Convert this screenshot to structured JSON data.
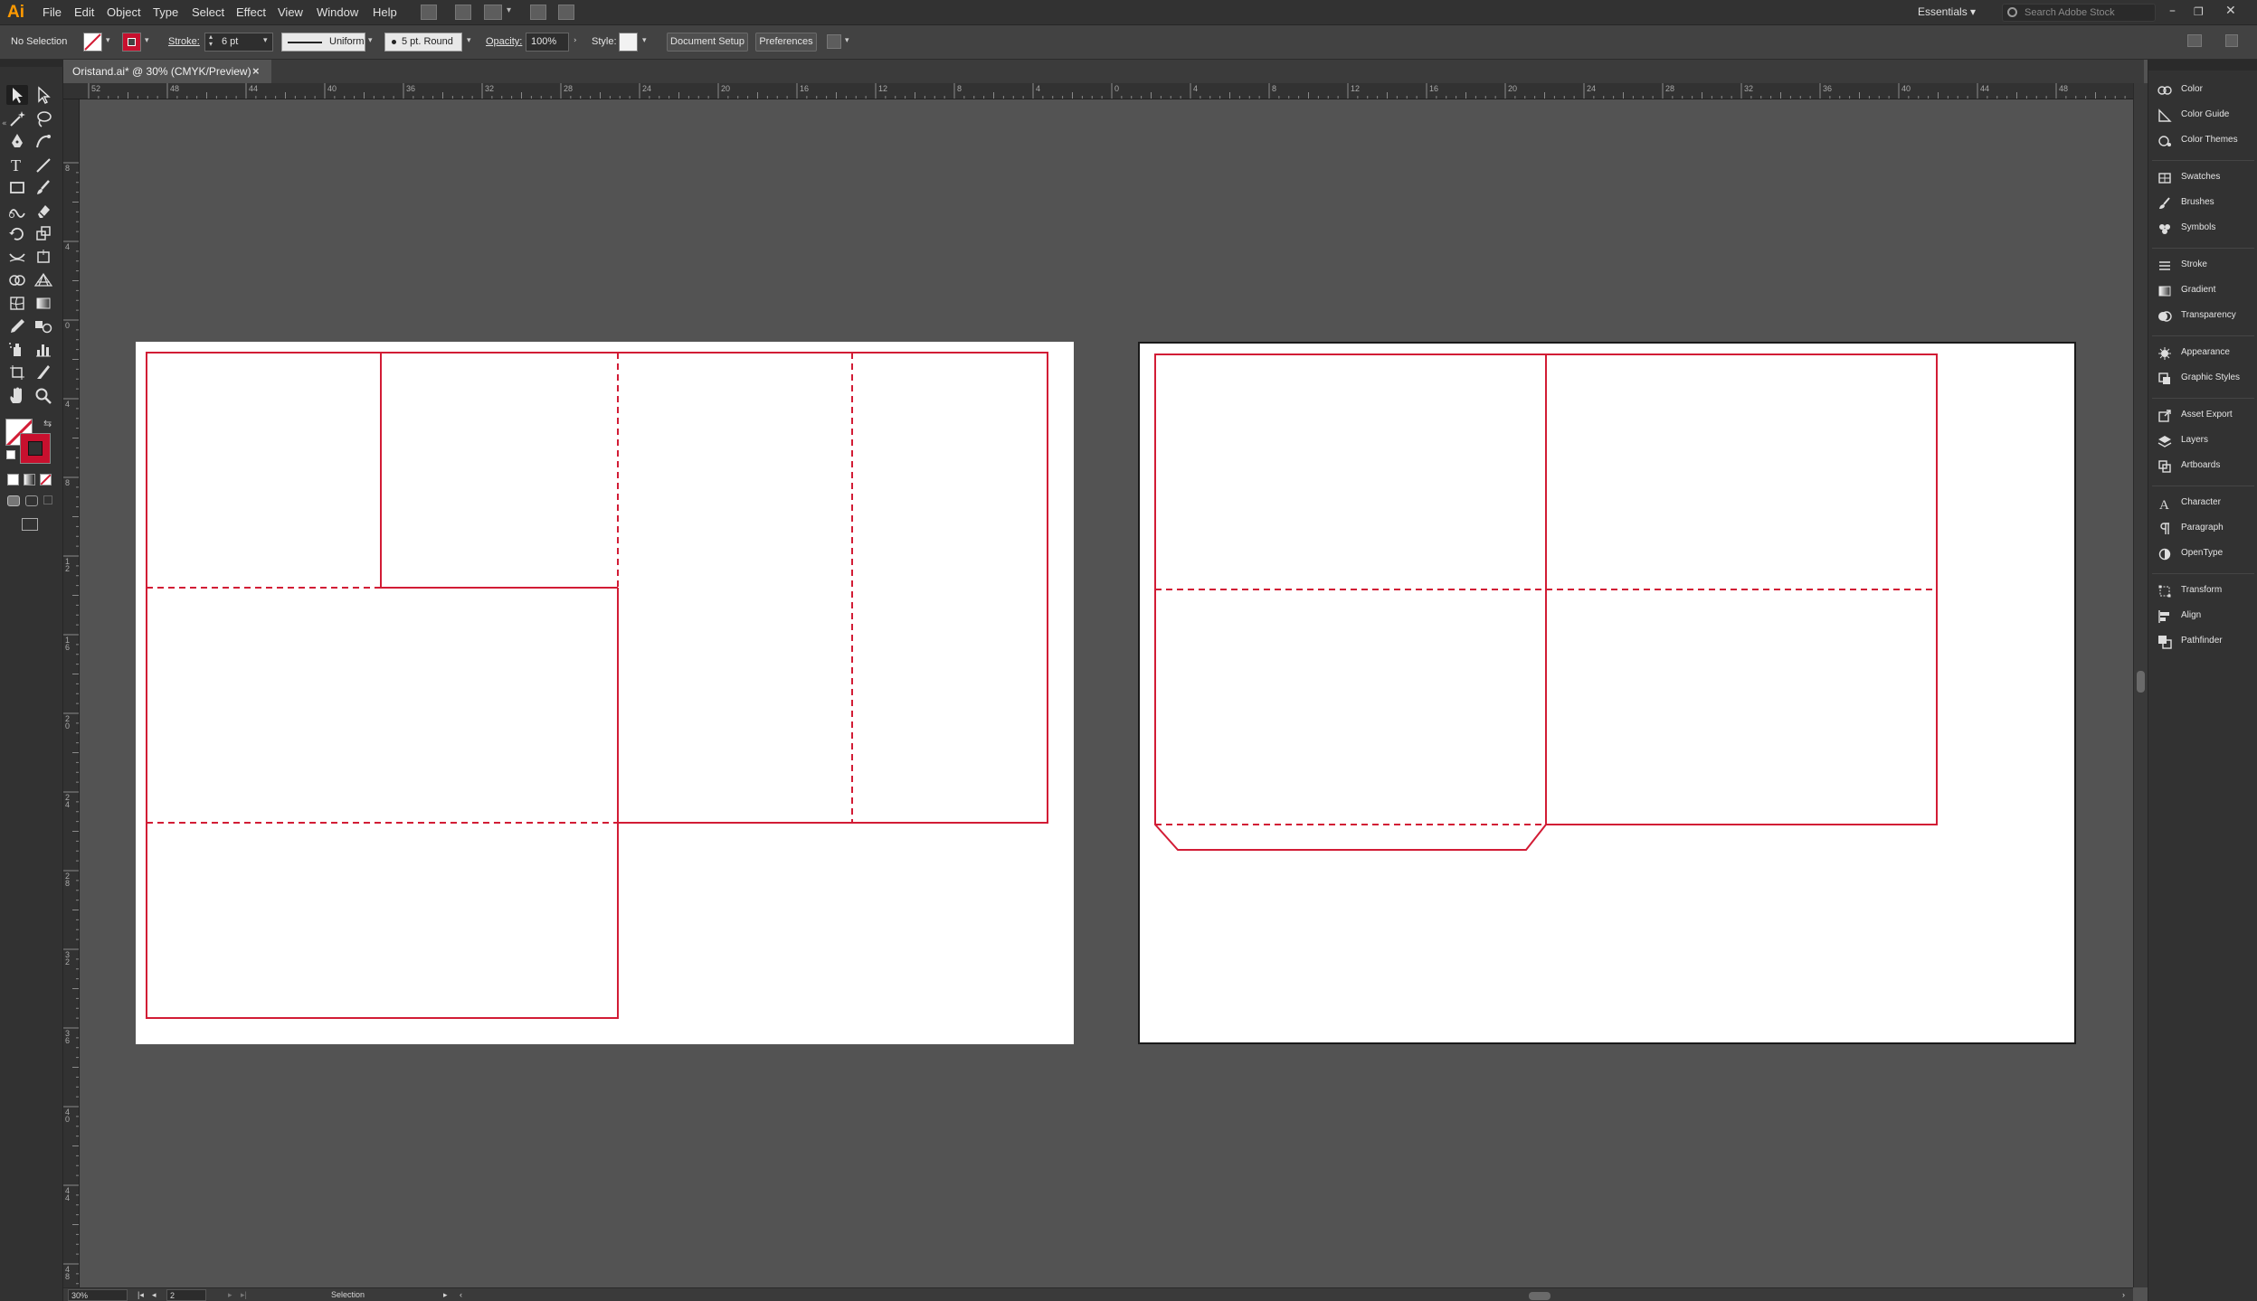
{
  "app": {
    "logo": "Ai",
    "accent": "#ff9a00"
  },
  "menubar": {
    "items": [
      "File",
      "Edit",
      "Object",
      "Type",
      "Select",
      "Effect",
      "View",
      "Window",
      "Help"
    ],
    "workspace": "Essentials",
    "search_placeholder": "Search Adobe Stock",
    "window_controls": [
      "minimize-icon",
      "restore-icon",
      "close-icon"
    ]
  },
  "controlbar": {
    "selection_state": "No Selection",
    "stroke_label": "Stroke:",
    "stroke_weight": "6 pt",
    "stroke_profile": "Uniform",
    "brush": "5 pt. Round",
    "opacity_label": "Opacity:",
    "opacity_value": "100%",
    "style_label": "Style:",
    "document_setup": "Document Setup",
    "preferences": "Preferences"
  },
  "document": {
    "tab_title": "Oristand.ai* @ 30% (CMYK/Preview)",
    "close_glyph": "×"
  },
  "rulers": {
    "top_labels": [
      "52",
      "48",
      "44",
      "40",
      "36",
      "32",
      "28",
      "24",
      "20",
      "16",
      "12",
      "8",
      "4",
      "0",
      "4",
      "8",
      "12",
      "16",
      "20",
      "24",
      "28",
      "32",
      "36",
      "40",
      "44",
      "48"
    ],
    "left_labels": [
      "8",
      "4",
      "0",
      "4",
      "8",
      "1 2",
      "1 6",
      "2 0",
      "2 4",
      "2 8",
      "3 2",
      "3 6",
      "4 0",
      "4 4",
      "4 8"
    ]
  },
  "statusbar": {
    "zoom": "30%",
    "artboard_number": "2",
    "current_tool": "Selection"
  },
  "colors": {
    "cut_line": "#d21c35",
    "canvas": "#535353",
    "chrome_dark": "#323232",
    "stroke_swatch": "#c8102e"
  },
  "tools": [
    "selection-tool",
    "direct-selection-tool",
    "magic-wand-tool",
    "lasso-tool",
    "pen-tool",
    "curvature-tool",
    "type-tool",
    "line-segment-tool",
    "rectangle-tool",
    "paintbrush-tool",
    "shaper-tool",
    "eraser-tool",
    "rotate-tool",
    "scale-tool",
    "width-tool",
    "free-transform-tool",
    "shape-builder-tool",
    "perspective-grid-tool",
    "mesh-tool",
    "gradient-tool",
    "eyedropper-tool",
    "blend-tool",
    "symbol-sprayer-tool",
    "column-graph-tool",
    "artboard-tool",
    "slice-tool",
    "hand-tool",
    "zoom-tool"
  ],
  "panels": [
    {
      "label": "Color",
      "icon": "color-icon"
    },
    {
      "label": "Color Guide",
      "icon": "color-guide-icon"
    },
    {
      "label": "Color Themes",
      "icon": "color-themes-icon"
    },
    {
      "label": "Swatches",
      "icon": "swatches-icon"
    },
    {
      "label": "Brushes",
      "icon": "brushes-icon"
    },
    {
      "label": "Symbols",
      "icon": "symbols-icon"
    },
    {
      "label": "Stroke",
      "icon": "stroke-icon"
    },
    {
      "label": "Gradient",
      "icon": "gradient-icon"
    },
    {
      "label": "Transparency",
      "icon": "transparency-icon"
    },
    {
      "label": "Appearance",
      "icon": "appearance-icon"
    },
    {
      "label": "Graphic Styles",
      "icon": "graphic-styles-icon"
    },
    {
      "label": "Asset Export",
      "icon": "asset-export-icon"
    },
    {
      "label": "Layers",
      "icon": "layers-icon"
    },
    {
      "label": "Artboards",
      "icon": "artboards-icon"
    },
    {
      "label": "Character",
      "icon": "character-icon"
    },
    {
      "label": "Paragraph",
      "icon": "paragraph-icon"
    },
    {
      "label": "OpenType",
      "icon": "opentype-icon"
    },
    {
      "label": "Transform",
      "icon": "transform-icon"
    },
    {
      "label": "Align",
      "icon": "align-icon"
    },
    {
      "label": "Pathfinder",
      "icon": "pathfinder-icon"
    }
  ]
}
